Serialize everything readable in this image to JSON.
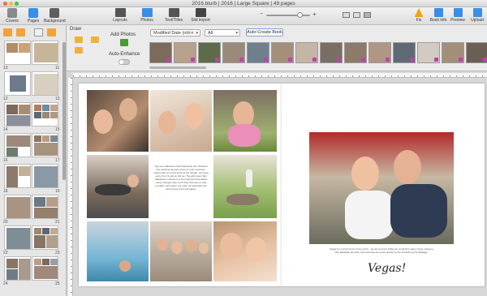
{
  "window": {
    "title": "2016.blurb | 2016 | Large Square | 49 pages"
  },
  "left_panel": {
    "tabs": [
      {
        "label": "Covers",
        "color": "#7a7a7a"
      },
      {
        "label": "Pages",
        "color": "#3a8ee6"
      },
      {
        "label": "Background",
        "color": "#6b6b6b"
      }
    ],
    "page_numbers": [
      "10",
      "11",
      "12",
      "13",
      "14",
      "15",
      "16",
      "17",
      "18",
      "19",
      "20",
      "21",
      "22",
      "23",
      "24",
      "25"
    ]
  },
  "toolbar": {
    "layouts_label": "Layouts",
    "photos_label": "Photos",
    "text_titles_label": "Text/Titles",
    "slide_import_label": "Slid import",
    "fix_label": "Fix",
    "book_info_label": "Book info",
    "preview_label": "Preview",
    "upload_label": "Upload"
  },
  "photo_panel": {
    "draw_label": "Draw",
    "add_photos_label": "Add Photos",
    "auto_enhance_label": "Auto-Enhance",
    "sort_select": "Modified Date (old-n",
    "filter_select": "All",
    "auto_create_label": "Auto-Create Book"
  },
  "spread": {
    "left_text": "Trip over Halloween fall break/early Jan. Wouldn't stop pushing the kids around on the log flume, eating way too much pizza at the arcade. He loved every bit of it and so did we. The girls wore their Halloween costumes to the hotel pool and asked every stranger they met if they had seen a real pumpkin. We swam, we rode, we slept late and came home tired and happy.",
    "right_caption": "Vegas for a work trip for Jonny and I - we ate at every buffet we could find, saw a show, played a little blackjack and lost, and took way too many photos by the fountains at the Bellagio.",
    "signature": "Vegas!"
  },
  "colors": {
    "accent": "#3a8ee6",
    "check": "#c13fb3",
    "auto_create_border": "#7ea6d9"
  }
}
